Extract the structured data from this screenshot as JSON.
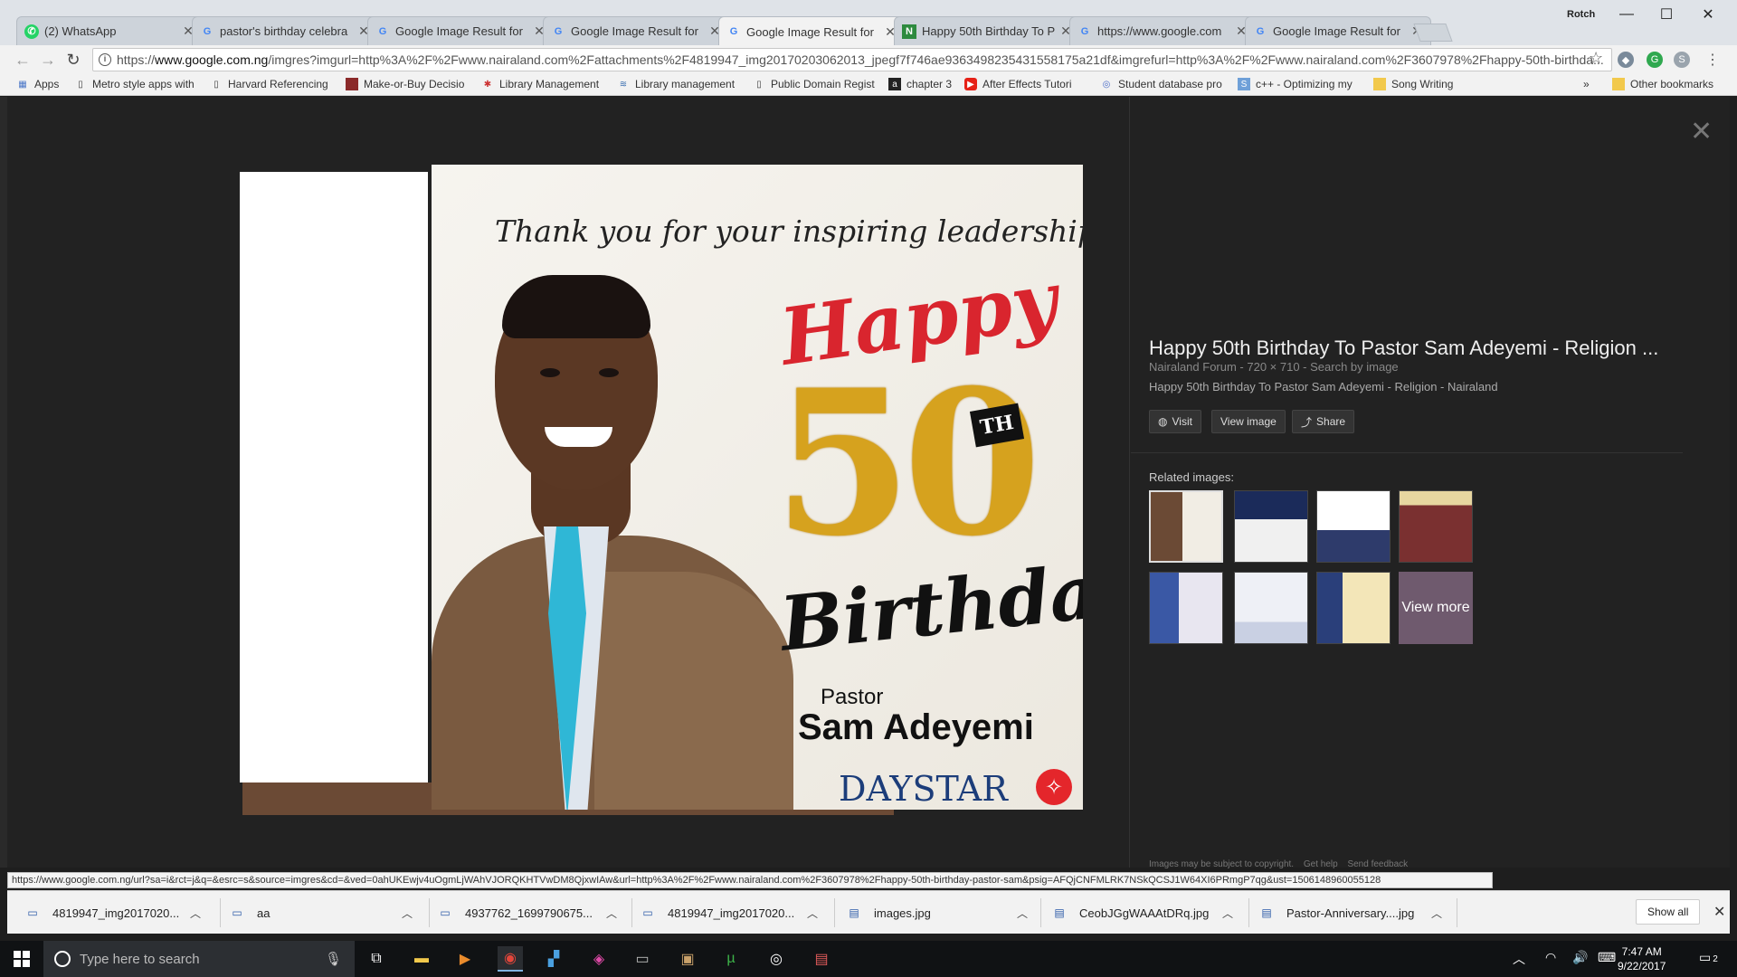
{
  "browser": {
    "tabs": [
      {
        "label": "(2) WhatsApp",
        "icon": "whatsapp-icon",
        "active": false
      },
      {
        "label": "pastor's birthday celebra",
        "icon": "google-icon",
        "active": false
      },
      {
        "label": "Google Image Result for",
        "icon": "google-icon",
        "active": false
      },
      {
        "label": "Google Image Result for",
        "icon": "google-icon",
        "active": false
      },
      {
        "label": "Google Image Result for",
        "icon": "google-icon",
        "active": true
      },
      {
        "label": "Happy 50th Birthday To P",
        "icon": "nairaland-icon",
        "active": false
      },
      {
        "label": "https://www.google.com",
        "icon": "google-icon",
        "active": false
      },
      {
        "label": "Google Image Result for",
        "icon": "google-icon",
        "active": false
      }
    ],
    "user": "Rotch",
    "url_prefix": "https://",
    "url_host": "www.google.com.ng",
    "url_rest": "/imgres?imgurl=http%3A%2F%2Fwww.nairaland.com%2Fattachments%2F4819947_img20170203062013_jpegf7f746ae9363498235431558175a21df&imgrefurl=http%3A%2F%2Fwww.nairaland.com%2F3607978%2Fhappy-50th-birthda...",
    "bookmarks": [
      {
        "label": "Apps",
        "icon": "apps-grid-icon"
      },
      {
        "label": "Metro style apps with",
        "icon": "page-icon"
      },
      {
        "label": "Harvard Referencing",
        "icon": "page-icon"
      },
      {
        "label": "Make-or-Buy Decisio",
        "icon": "book-icon"
      },
      {
        "label": "Library Management",
        "icon": "cluster-icon"
      },
      {
        "label": "Library management",
        "icon": "stack-icon"
      },
      {
        "label": "Public Domain Regist",
        "icon": "page-icon"
      },
      {
        "label": "chapter 3",
        "icon": "a-icon"
      },
      {
        "label": "After Effects Tutori",
        "icon": "youtube-icon"
      },
      {
        "label": "Student database pro",
        "icon": "swirl-icon"
      },
      {
        "label": "c++ - Optimizing my",
        "icon": "so-icon"
      },
      {
        "label": "Song Writing",
        "icon": "folder-icon"
      }
    ],
    "more_bookmarks": "»",
    "other_bookmarks": "Other bookmarks"
  },
  "card": {
    "thankyou": "Thank you for your inspiring leadership!",
    "happy": "Happy",
    "number": "50",
    "suffix": "TH",
    "birthday": "Birthday",
    "pastor": "Pastor",
    "name": "Sam Adeyemi",
    "brand": "DAYSTAR"
  },
  "panel": {
    "title": "Happy 50th Birthday To Pastor Sam Adeyemi - Religion ...",
    "meta": "Nairaland Forum - 720 × 710 - Search by image",
    "description": "Happy 50th Birthday To Pastor Sam Adeyemi - Religion - Nairaland",
    "visit": "Visit",
    "view_image": "View image",
    "share": "Share",
    "related_label": "Related images:",
    "view_more": "View more",
    "copyright": "Images may be subject to copyright.",
    "get_help": "Get help",
    "send_feedback": "Send feedback"
  },
  "status_url": "https://www.google.com.ng/url?sa=i&rct=j&q=&esrc=s&source=imgres&cd=&ved=0ahUKEwjv4uOgmLjWAhVJORQKHTVwDM8QjxwIAw&url=http%3A%2F%2Fwww.nairaland.com%2F3607978%2Fhappy-50th-birthday-pastor-sam&psig=AFQjCNFMLRK7NSkQCSJ1W64XI6PRmgP7qg&ust=1506148960055128",
  "downloads": [
    {
      "name": "4819947_img2017020...",
      "icon": "download-file-icon"
    },
    {
      "name": "aa",
      "icon": "download-file-icon"
    },
    {
      "name": "4937762_1699790675...",
      "icon": "download-file-icon"
    },
    {
      "name": "4819947_img2017020...",
      "icon": "download-file-icon"
    },
    {
      "name": "images.jpg",
      "icon": "image-file-icon"
    },
    {
      "name": "CeobJGgWAAAtDRq.jpg",
      "icon": "image-file-icon"
    },
    {
      "name": "Pastor-Anniversary....jpg",
      "icon": "image-file-icon"
    }
  ],
  "show_all": "Show all",
  "taskbar": {
    "search_placeholder": "Type here to search",
    "time": "7:47 AM",
    "date": "9/22/2017",
    "notification_count": "2"
  },
  "colors": {
    "accent_red": "#d9252e",
    "gold": "#d6a21e",
    "daystar_blue": "#1c3d7a",
    "tie_blue": "#2fb7d6"
  }
}
